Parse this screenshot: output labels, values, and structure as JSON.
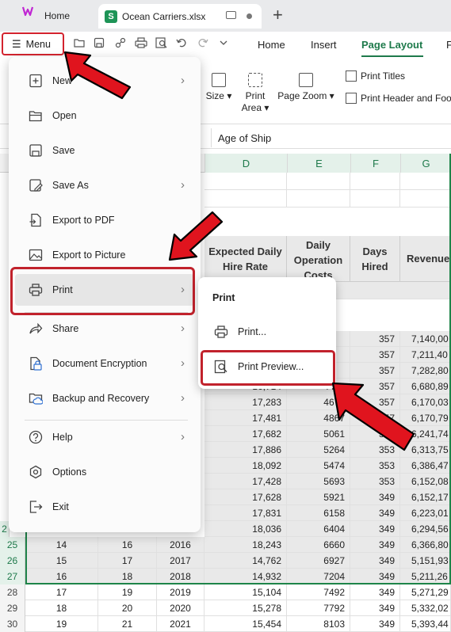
{
  "tabs": {
    "home_label": "Home",
    "file_label": "Ocean Carriers.xlsx",
    "sheet_badge": "S"
  },
  "ribbon": {
    "menu_label": "Menu",
    "tabs": [
      "Home",
      "Insert",
      "Page Layout",
      "F"
    ],
    "active_tab": "Page Layout",
    "accent_color": "#1e7a4b"
  },
  "tools": {
    "size": "Size",
    "print_area_1": "Print",
    "print_area_2": "Area",
    "page_zoom": "Page Zoom",
    "print_titles": "Print Titles",
    "print_header_footer": "Print Header and Foot"
  },
  "formula": {
    "content": "Age of Ship"
  },
  "grid": {
    "col_headers": [
      "D",
      "E",
      "F",
      "G"
    ],
    "header_row": {
      "d": "Expected Daily Hire Rate",
      "e": "Daily Operation Costs",
      "f": "Days Hired",
      "g": "Revenue"
    },
    "partial_rows": [
      {
        "f": "357",
        "g": "7,140,00"
      },
      {
        "f": "357",
        "g": "7,211,40"
      },
      {
        "f": "357",
        "g": "7,282,80"
      },
      {
        "d": "16,714",
        "e": "4499",
        "f": "357",
        "g": "6,680,89"
      },
      {
        "d": "17,283",
        "e": "4679",
        "f": "357",
        "g": "6,170,03"
      },
      {
        "d": "17,481",
        "e": "4867",
        "f": "357",
        "g": "6,170,79"
      },
      {
        "d": "17,682",
        "e": "5061",
        "f": "353",
        "g": "6,241,74"
      },
      {
        "d": "17,886",
        "e": "5264",
        "f": "353",
        "g": "6,313,75"
      },
      {
        "d": "18,092",
        "e": "5474",
        "f": "353",
        "g": "6,386,47"
      },
      {
        "d": "17,428",
        "e": "5693",
        "f": "353",
        "g": "6,152,08"
      },
      {
        "d": "17,628",
        "e": "5921",
        "f": "349",
        "g": "6,152,17"
      },
      {
        "d": "17,831",
        "e": "6158",
        "f": "349",
        "g": "6,223,01"
      },
      {
        "d": "18,036",
        "e": "6404",
        "f": "349",
        "g": "6,294,56"
      }
    ],
    "full_rows": [
      {
        "row": "25",
        "a": "14",
        "b": "16",
        "c": "2016",
        "d": "18,243",
        "e": "6660",
        "f": "349",
        "g": "6,366,80"
      },
      {
        "row": "26",
        "a": "15",
        "b": "17",
        "c": "2017",
        "d": "14,762",
        "e": "6927",
        "f": "349",
        "g": "5,151,93"
      },
      {
        "row": "27",
        "a": "16",
        "b": "18",
        "c": "2018",
        "d": "14,932",
        "e": "7204",
        "f": "349",
        "g": "5,211,26"
      },
      {
        "row": "28",
        "a": "17",
        "b": "19",
        "c": "2019",
        "d": "15,104",
        "e": "7492",
        "f": "349",
        "g": "5,271,29"
      },
      {
        "row": "29",
        "a": "18",
        "b": "20",
        "c": "2020",
        "d": "15,278",
        "e": "7792",
        "f": "349",
        "g": "5,332,02"
      },
      {
        "row": "30",
        "a": "19",
        "b": "21",
        "c": "2021",
        "d": "15,454",
        "e": "8103",
        "f": "349",
        "g": "5,393,44"
      }
    ],
    "partial_row_num": "2"
  },
  "menu": {
    "items": [
      {
        "label": "New"
      },
      {
        "label": "Open"
      },
      {
        "label": "Save"
      },
      {
        "label": "Save As"
      },
      {
        "label": "Export to PDF"
      },
      {
        "label": "Export to Picture"
      },
      {
        "label": "Print"
      },
      {
        "label": "Share"
      },
      {
        "label": "Document Encryption"
      },
      {
        "label": "Backup and Recovery"
      },
      {
        "label": "Help"
      },
      {
        "label": "Options"
      },
      {
        "label": "Exit"
      }
    ]
  },
  "submenu": {
    "title": "Print",
    "items": [
      {
        "label": "Print..."
      },
      {
        "label": "Print Preview..."
      }
    ]
  },
  "annotation_color": "#e0141e"
}
